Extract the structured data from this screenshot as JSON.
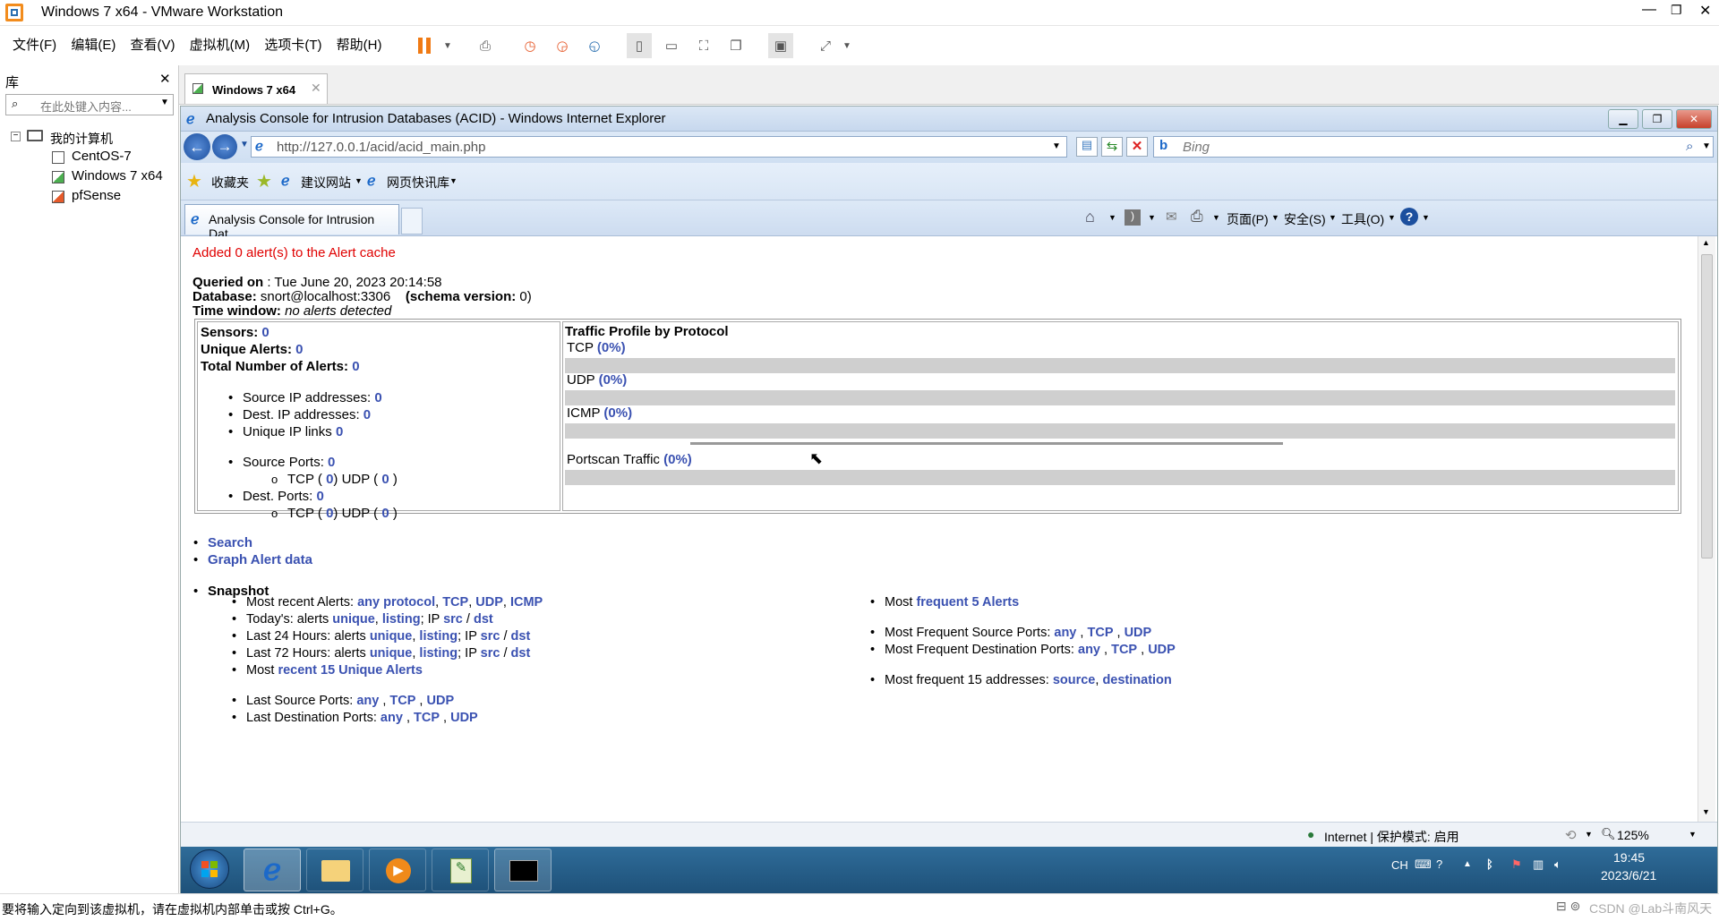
{
  "vmware": {
    "title": "Windows 7 x64 - VMware Workstation",
    "menu": [
      "文件(F)",
      "编辑(E)",
      "查看(V)",
      "虚拟机(M)",
      "选项卡(T)",
      "帮助(H)"
    ],
    "library": {
      "title": "库",
      "search_placeholder": "在此处键入内容...",
      "root": "我的计算机",
      "vms": [
        "CentOS-7",
        "Windows 7 x64",
        "pfSense"
      ]
    },
    "tab": "Windows 7 x64",
    "status_text": "要将输入定向到该虚拟机，请在虚拟机内部单击或按 Ctrl+G。"
  },
  "ie": {
    "window_title": "Analysis Console for Intrusion Databases (ACID) - Windows Internet Explorer",
    "url": "http://127.0.0.1/acid/acid_main.php",
    "search_placeholder": "Bing",
    "favorites": "收藏夹",
    "suggested_sites": "建议网站",
    "web_slices": "网页快讯库",
    "tab_title": "Analysis Console for Intrusion Dat...",
    "cmd_page": "页面(P)",
    "cmd_safety": "安全(S)",
    "cmd_tools": "工具(O)",
    "status_zone": "Internet | 保护模式: 启用",
    "zoom": "125%"
  },
  "acid": {
    "cache_msg": "Added 0 alert(s) to the Alert cache",
    "queried_label": "Queried on",
    "queried_value": " : Tue June 20, 2023 20:14:58",
    "database_label": "Database:",
    "database_value": " snort@localhost:3306",
    "schema_label": "(schema version:",
    "schema_value": " 0)",
    "timewindow_label": "Time window:",
    "timewindow_value": " no alerts detected",
    "sensors_label": "Sensors:",
    "sensors_value": "0",
    "unique_label": "Unique Alerts:",
    "unique_value": "0",
    "total_label": "Total Number of Alerts:",
    "total_value": "0",
    "src_ip_label": "Source IP addresses:",
    "src_ip_value": "0",
    "dst_ip_label": "Dest. IP addresses:",
    "dst_ip_value": "0",
    "links_label": "Unique IP links",
    "links_value": "0",
    "src_ports_label": "Source Ports:",
    "src_ports_value": "0",
    "dst_ports_label": "Dest. Ports:",
    "dst_ports_value": "0",
    "port_tcp": "TCP (",
    "port_udp": ")  UDP (",
    "port_close": ")",
    "port_zero": "0",
    "traffic_title": "Traffic Profile by Protocol",
    "protocols": [
      {
        "name": "TCP",
        "pct": "(0%)",
        "fraction": 0
      },
      {
        "name": "UDP",
        "pct": "(0%)",
        "fraction": 0
      },
      {
        "name": "ICMP",
        "pct": "(0%)",
        "fraction": 0
      }
    ],
    "portscan_label": "Portscan Traffic",
    "portscan_pct": "(0%)",
    "portscan_fraction": 0,
    "link_search": "Search",
    "link_graph": "Graph Alert data",
    "snapshot_title": "Snapshot",
    "left_lines": [
      {
        "text": "Most recent Alerts: ",
        "links": [
          "any protocol",
          "TCP",
          "UDP",
          "ICMP"
        ]
      },
      {
        "text": "Today's: alerts ",
        "links": [
          "unique",
          "listing"
        ],
        "ip": true
      },
      {
        "text": "Last 24 Hours: alerts ",
        "links": [
          "unique",
          "listing"
        ],
        "ip": true
      },
      {
        "text": "Last 72 Hours: alerts ",
        "links": [
          "unique",
          "listing"
        ],
        "ip": true
      },
      {
        "text": "Most ",
        "links": [
          "recent 15 Unique Alerts"
        ]
      }
    ],
    "ip_label": "; IP ",
    "ip_src": "src",
    "ip_sep": " / ",
    "ip_dst": "dst",
    "last_src_ports": "Last Source Ports: ",
    "last_dst_ports": "Last Destination Ports: ",
    "port_links": [
      "any",
      "TCP",
      "UDP"
    ],
    "most_label": "Most ",
    "freq5": "frequent 5 Alerts",
    "freq_src_ports": "Most Frequent Source Ports: ",
    "freq_dst_ports": "Most Frequent Destination Ports: ",
    "freq15_label": "Most frequent 15 addresses: ",
    "freq15_src": "source",
    "freq15_dst": "destination"
  },
  "taskbar": {
    "lang": "CH",
    "time": "19:45",
    "date": "2023/6/21"
  },
  "watermark": "CSDN @Lab斗南风天"
}
